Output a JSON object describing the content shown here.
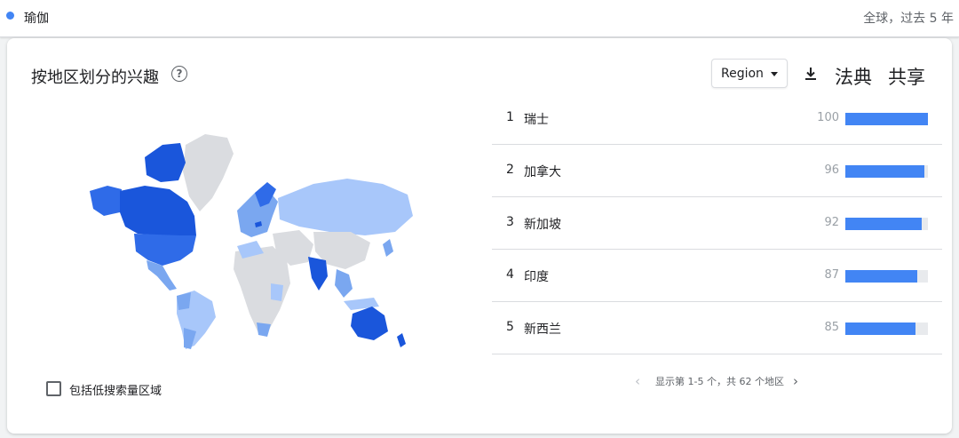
{
  "header": {
    "term": "瑜伽",
    "term_color": "#4285f4",
    "scope": "全球，过去 5 年"
  },
  "card": {
    "title": "按地区划分的兴趣",
    "help_icon": "help-circle-icon",
    "region_select": "Region",
    "download_icon": "download-icon",
    "embed_label": "法典",
    "share_label": "共享"
  },
  "map": {
    "colors": {
      "darkest": "#1a56db",
      "strong": "#2f6be8",
      "medium": "#7aa7f0",
      "light": "#a8c7fa",
      "nodata": "#dadce0"
    }
  },
  "ranking": [
    {
      "rank": "1",
      "name": "瑞士",
      "value": 100
    },
    {
      "rank": "2",
      "name": "加拿大",
      "value": 96
    },
    {
      "rank": "3",
      "name": "新加坡",
      "value": 92
    },
    {
      "rank": "4",
      "name": "印度",
      "value": 87
    },
    {
      "rank": "5",
      "name": "新西兰",
      "value": 85
    }
  ],
  "low_volume_label": "包括低搜索量区域",
  "pagination": {
    "text": "显示第 1-5 个，共 62 个地区",
    "prev_icon": "chevron-left-icon",
    "next_icon": "chevron-right-icon"
  }
}
